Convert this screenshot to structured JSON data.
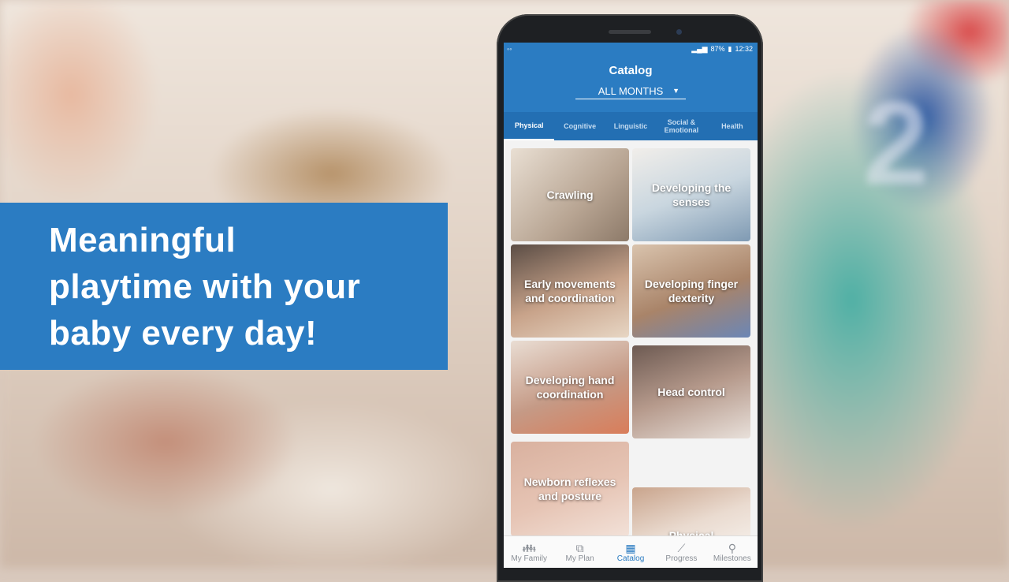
{
  "caption": {
    "text": "Meaningful\nplaytime with your\nbaby every day!"
  },
  "status": {
    "battery": "87%",
    "time": "12:32"
  },
  "header": {
    "title": "Catalog",
    "filter_value": "ALL MONTHS"
  },
  "tabs": [
    {
      "label": "Physical",
      "active": true
    },
    {
      "label": "Cognitive"
    },
    {
      "label": "Linguistic"
    },
    {
      "label": "Social &\nEmotional"
    },
    {
      "label": "Health"
    }
  ],
  "cards": [
    {
      "label": "Crawling"
    },
    {
      "label": "Developing the senses"
    },
    {
      "label": "Early movements and coordination"
    },
    {
      "label": "Developing finger dexterity"
    },
    {
      "label": "Developing hand coordination"
    },
    {
      "label": "Head control"
    },
    {
      "label": "Newborn reflexes and posture"
    },
    {
      "label": "Physical"
    }
  ],
  "bottom_nav": [
    {
      "label": "My Family",
      "icon": "family-icon"
    },
    {
      "label": "My Plan",
      "icon": "blocks-icon"
    },
    {
      "label": "Catalog",
      "icon": "catalog-icon",
      "active": true
    },
    {
      "label": "Progress",
      "icon": "chart-icon"
    },
    {
      "label": "Milestones",
      "icon": "pin-icon"
    }
  ],
  "colors": {
    "brand_blue": "#2b7cc2",
    "tab_bar": "#236fb3"
  }
}
